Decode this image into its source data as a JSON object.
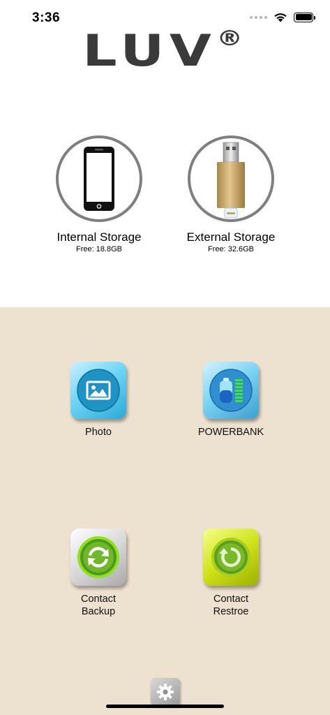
{
  "status_bar": {
    "time": "3:36"
  },
  "logo": {
    "text": "LUV",
    "mark": "®"
  },
  "storage": {
    "internal": {
      "title": "Internal Storage",
      "free": "Free: 18.8GB",
      "icon": "phone-icon"
    },
    "external": {
      "title": "External Storage",
      "free": "Free: 32.6GB",
      "icon": "usb-drive-icon"
    }
  },
  "tiles": {
    "photo": {
      "label": "Photo",
      "icon": "photo-icon"
    },
    "powerbank": {
      "label": "POWERBANK",
      "icon": "battery-icon"
    },
    "contact_backup": {
      "label_line1": "Contact",
      "label_line2": "Backup",
      "icon": "sync-arrows-icon"
    },
    "contact_restore": {
      "label_line1": "Contact",
      "label_line2": "Restroe",
      "icon": "restore-arrow-icon"
    }
  },
  "settings": {
    "icon": "gear-icon"
  },
  "colors": {
    "panel_background": "#ede1cf",
    "ring": "#7f7f7f",
    "logo": "#3a3a3a",
    "restore_green": "#cfe21b",
    "backup_green": "#7fd11a"
  }
}
